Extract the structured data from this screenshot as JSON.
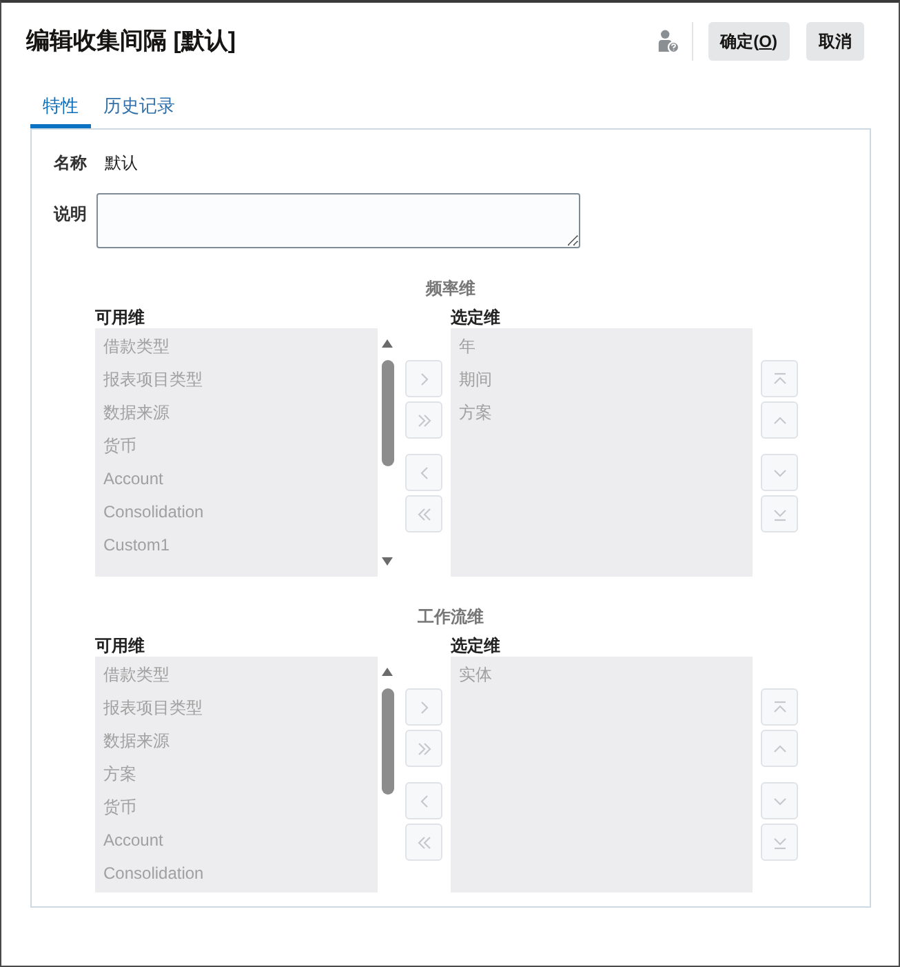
{
  "dialog": {
    "title": "编辑收集间隔 [默认]"
  },
  "actions": [
    {
      "label_before": "确定(",
      "access_key": "O",
      "label_after": ")"
    },
    {
      "label_before": "取消"
    }
  ],
  "tabs": [
    {
      "label": "特性",
      "selected": true
    },
    {
      "label": "历史记录",
      "selected": false
    }
  ],
  "form": {
    "name_label": "名称",
    "name_value": "默认",
    "description_label": "说明"
  },
  "sections": [
    {
      "title": "频率维",
      "available": {
        "label": "可用维",
        "disabled": true,
        "items": [
          "借款类型",
          "报表项目类型",
          "数据来源",
          "货币",
          "Account",
          "Consolidation",
          "Custom1"
        ]
      },
      "selected": {
        "label": "选定维",
        "disabled": true,
        "items": [
          "年",
          "期间",
          "方案"
        ]
      },
      "move_buttons": [
        {
          "kind": "add",
          "disabled": true
        },
        {
          "kind": "add_all",
          "disabled": true
        },
        {
          "kind": "remove",
          "disabled": true
        },
        {
          "kind": "remove_all",
          "disabled": true
        }
      ],
      "order_buttons": [
        {
          "kind": "top",
          "disabled": true
        },
        {
          "kind": "up",
          "disabled": true
        },
        {
          "kind": "down",
          "disabled": true
        },
        {
          "kind": "bottom",
          "disabled": true
        }
      ]
    },
    {
      "title": "工作流维",
      "available": {
        "label": "可用维",
        "disabled": true,
        "items": [
          "借款类型",
          "报表项目类型",
          "数据来源",
          "方案",
          "货币",
          "Account",
          "Consolidation"
        ]
      },
      "selected": {
        "label": "选定维",
        "disabled": true,
        "items": [
          "实体"
        ]
      },
      "move_buttons": [
        {
          "kind": "add",
          "disabled": true
        },
        {
          "kind": "add_all",
          "disabled": true
        },
        {
          "kind": "remove",
          "disabled": true
        },
        {
          "kind": "remove_all",
          "disabled": true
        }
      ],
      "order_buttons": [
        {
          "kind": "top",
          "disabled": true
        },
        {
          "kind": "up",
          "disabled": true
        },
        {
          "kind": "down",
          "disabled": true
        },
        {
          "kind": "bottom",
          "disabled": true
        }
      ]
    }
  ]
}
